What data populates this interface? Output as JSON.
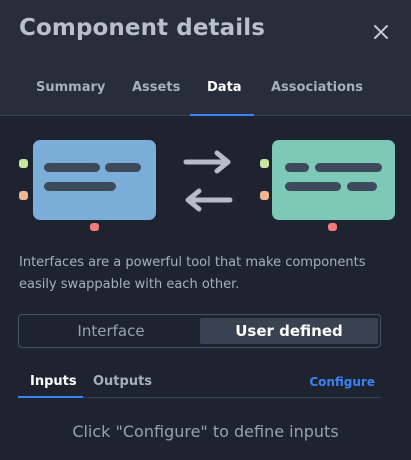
{
  "panel": {
    "title": "Component details",
    "close_icon": "close-icon"
  },
  "tabs": [
    {
      "label": "Summary",
      "active": false
    },
    {
      "label": "Assets",
      "active": false
    },
    {
      "label": "Data",
      "active": true
    },
    {
      "label": "Associations",
      "active": false
    }
  ],
  "illustration": {
    "left_card_color": "#7aaed8",
    "right_card_color": "#7ec8b8",
    "arrows": "swap-arrows-icon"
  },
  "description": "Interfaces are a powerful tool that make components easily swappable with each other.",
  "segmented": {
    "options": [
      "Interface",
      "User defined"
    ],
    "selected": "User defined"
  },
  "subtabs": {
    "items": [
      "Inputs",
      "Outputs"
    ],
    "active": "Inputs",
    "action": "Configure"
  },
  "empty_message": "Click \"Configure\" to define inputs",
  "colors": {
    "accent": "#3b82f6",
    "background": "#1e2330",
    "header": "#272d3a"
  }
}
